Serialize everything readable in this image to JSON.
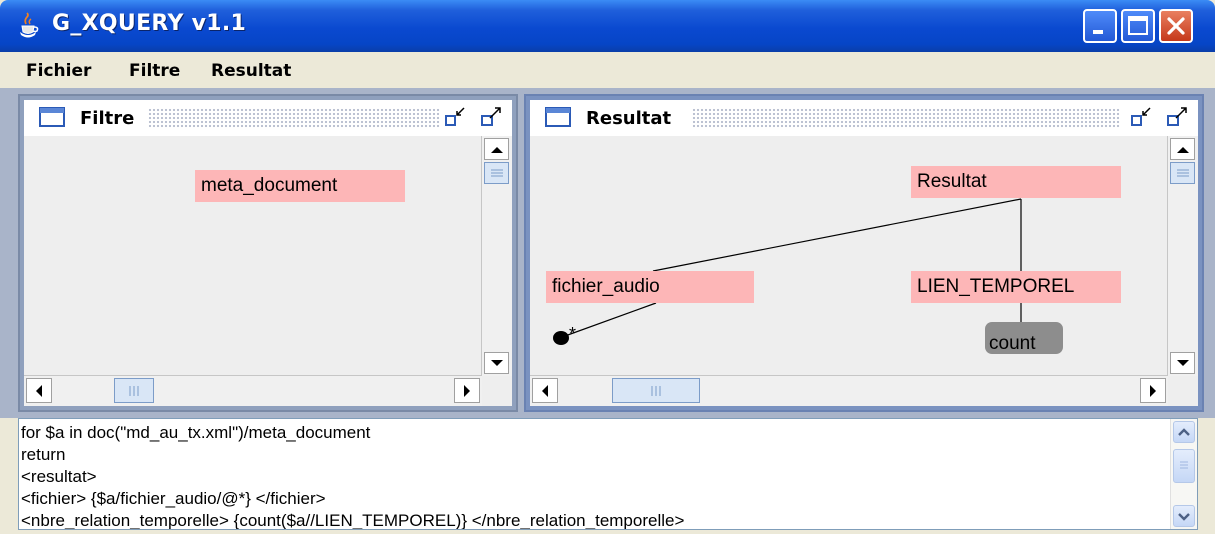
{
  "window": {
    "title": "G_XQUERY v1.1",
    "controls": {
      "minimize": "minimize-icon",
      "maximize": "maximize-icon",
      "close": "close-icon"
    }
  },
  "menubar": {
    "items": [
      "Fichier",
      "Filtre",
      "Resultat"
    ]
  },
  "panels": {
    "filtre": {
      "title": "Filtre",
      "nodes": [
        {
          "label": "meta_document",
          "kind": "element"
        }
      ]
    },
    "resultat": {
      "title": "Resultat",
      "nodes": [
        {
          "label": "Resultat",
          "kind": "element"
        },
        {
          "label": "fichier_audio",
          "kind": "element"
        },
        {
          "label": "LIEN_TEMPOREL",
          "kind": "element"
        },
        {
          "label": "count",
          "kind": "function"
        }
      ],
      "attribute_marker": "*",
      "edges": [
        [
          "Resultat",
          "fichier_audio"
        ],
        [
          "Resultat",
          "LIEN_TEMPOREL"
        ],
        [
          "LIEN_TEMPOREL",
          "count"
        ],
        [
          "fichier_audio",
          "*"
        ]
      ]
    }
  },
  "query": {
    "lines": [
      "for $a in doc(\"md_au_tx.xml\")/meta_document",
      "return",
      "<resultat>",
      "<fichier> {$a/fichier_audio/@*} </fichier>",
      "<nbre_relation_temporelle> {count($a//LIEN_TEMPOREL)} </nbre_relation_temporelle>"
    ]
  },
  "colors": {
    "titlebar": "#0A49D0",
    "element_node": "#FDB6B7",
    "function_node": "#8D8D8D",
    "close_button": "#C5381A"
  }
}
